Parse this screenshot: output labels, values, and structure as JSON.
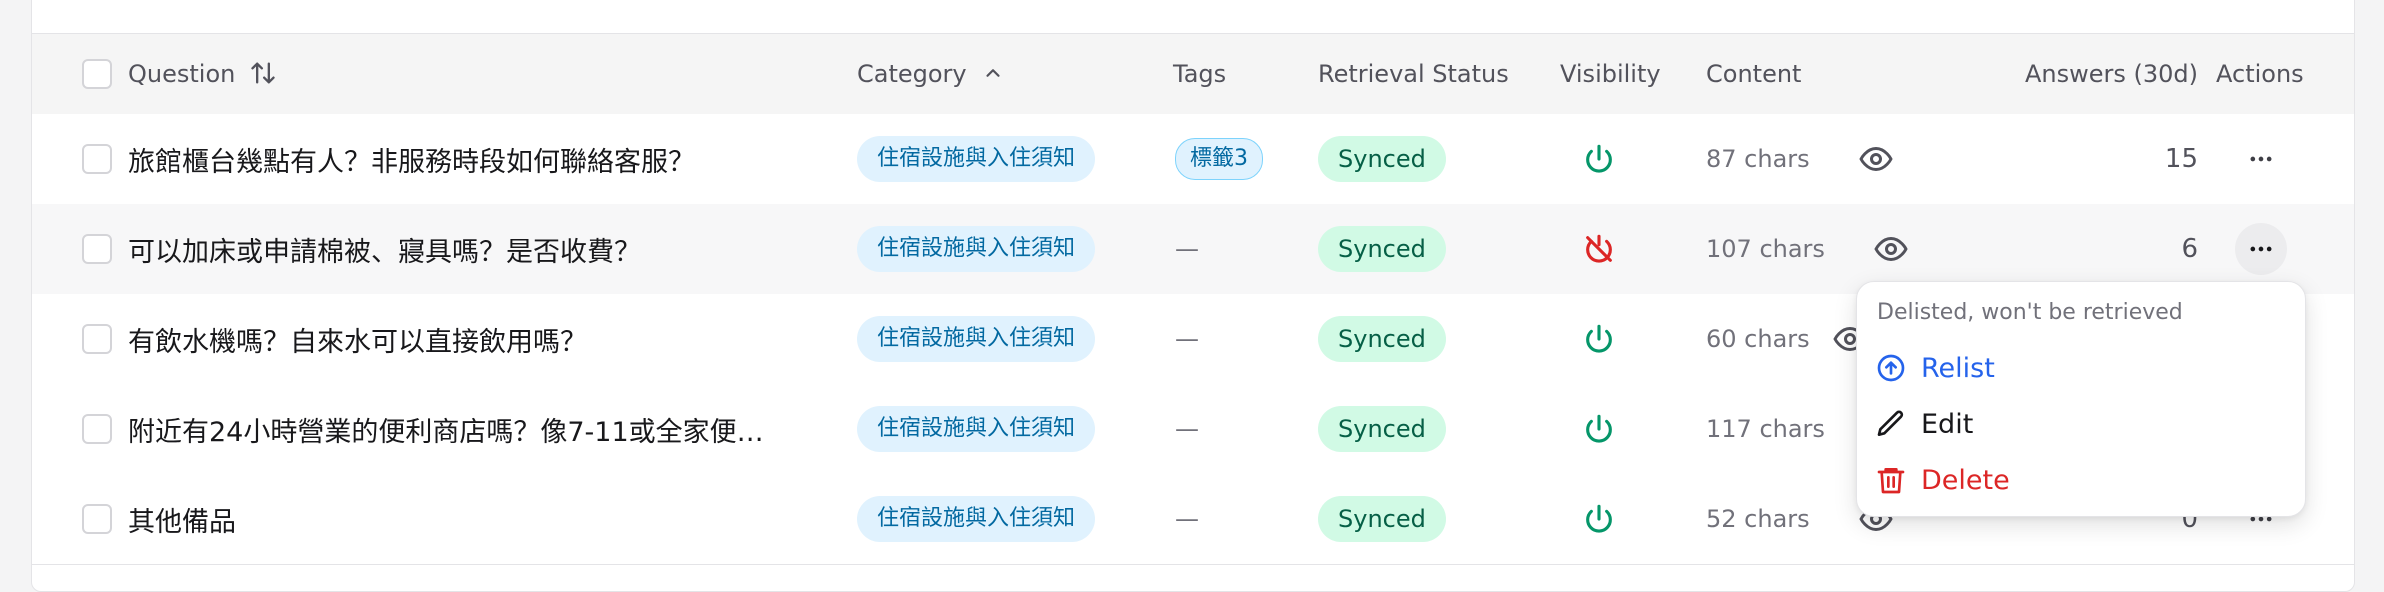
{
  "columns": {
    "question": "Question",
    "category": "Category",
    "tags": "Tags",
    "retrieval_status": "Retrieval Status",
    "visibility": "Visibility",
    "content": "Content",
    "answers": "Answers (30d)",
    "actions": "Actions"
  },
  "rows": [
    {
      "question": "旅館櫃台幾點有人？非服務時段如何聯絡客服？",
      "category": "住宿設施與入住須知",
      "tag": "標籤3",
      "status": "Synced",
      "visibility": "listed",
      "content": "87 chars",
      "answers": "15"
    },
    {
      "question": "可以加床或申請棉被、寢具嗎？是否收費？",
      "category": "住宿設施與入住須知",
      "tag": "—",
      "status": "Synced",
      "visibility": "delisted",
      "content": "107 chars",
      "answers": "6"
    },
    {
      "question": "有飲水機嗎？自來水可以直接飲用嗎？",
      "category": "住宿設施與入住須知",
      "tag": "—",
      "status": "Synced",
      "visibility": "listed",
      "content": "60 chars",
      "answers": ""
    },
    {
      "question": "附近有24小時營業的便利商店嗎？像7-11或全家便…",
      "category": "住宿設施與入住須知",
      "tag": "—",
      "status": "Synced",
      "visibility": "listed",
      "content": "117 chars",
      "answers": ""
    },
    {
      "question": "其他備品",
      "category": "住宿設施與入住須知",
      "tag": "—",
      "status": "Synced",
      "visibility": "listed",
      "content": "52 chars",
      "answers": "0"
    }
  ],
  "menu": {
    "note": "Delisted, won't be retrieved",
    "relist": "Relist",
    "edit": "Edit",
    "delete": "Delete"
  },
  "colors": {
    "listed_green": "#059669",
    "delisted_red": "#dc2626",
    "relist_blue": "#2563eb",
    "delete_red": "#dc2626"
  }
}
